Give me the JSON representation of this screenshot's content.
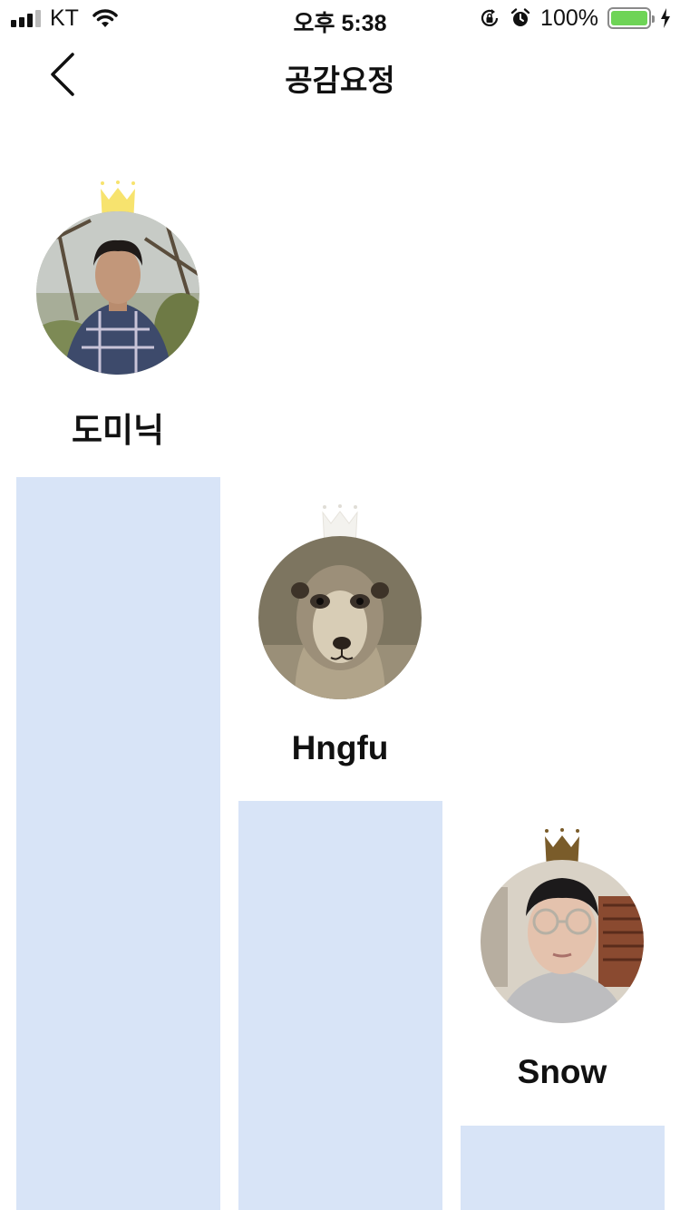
{
  "status_bar": {
    "carrier": "KT",
    "time": "오후 5:38",
    "battery_percent": "100%",
    "battery_level": 1.0,
    "colors": {
      "battery": "#6ed456"
    }
  },
  "nav": {
    "title": "공감요정",
    "back_icon": "chevron-left-icon"
  },
  "ranking": [
    {
      "rank": 1,
      "name": "도미닉",
      "crown_color": "#f7e36e",
      "score_level": 1.0
    },
    {
      "rank": 2,
      "name": "Hngfu",
      "crown_color": "#f3f2ee",
      "score_level": 0.56
    },
    {
      "rank": 3,
      "name": "Snow",
      "crown_color": "#7a5c2a",
      "score_level": 0.12
    }
  ],
  "colors": {
    "bar": "#d8e4f7",
    "background": "#ffffff"
  }
}
